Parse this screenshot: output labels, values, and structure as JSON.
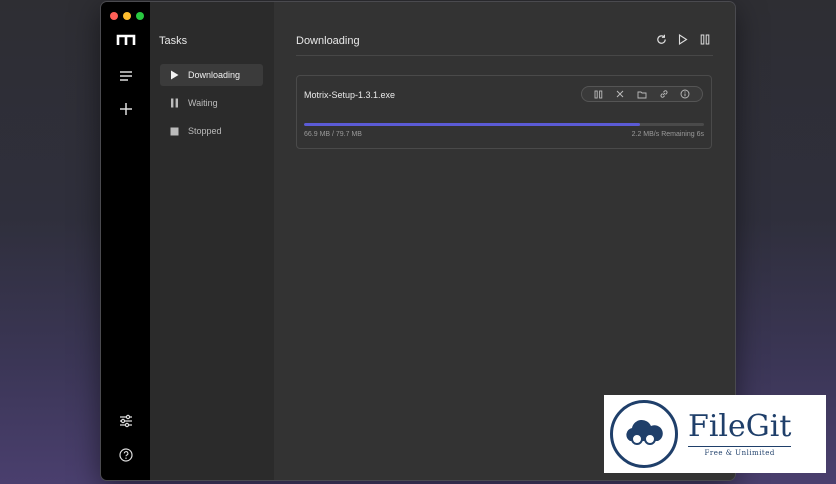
{
  "sidebar": {
    "logo_icon": "motrix-logo-icon",
    "menu_icon": "list-menu-icon",
    "add_icon": "plus-icon",
    "settings_icon": "sliders-icon",
    "help_icon": "help-circle-icon"
  },
  "subnav": {
    "title": "Tasks",
    "items": [
      {
        "label": "Downloading",
        "icon": "play-icon",
        "active": true
      },
      {
        "label": "Waiting",
        "icon": "pause-icon",
        "active": false
      },
      {
        "label": "Stopped",
        "icon": "stop-icon",
        "active": false
      }
    ]
  },
  "main": {
    "title": "Downloading",
    "actions": [
      "refresh-icon",
      "play-icon",
      "pause-icon"
    ]
  },
  "task": {
    "name": "Motrix-Setup-1.3.1.exe",
    "size": "66.9 MB / 79.7 MB",
    "speed": "2.2 MB/s Remaining 6s",
    "progress": 0.84,
    "actions": [
      "pause-icon",
      "close-icon",
      "folder-icon",
      "link-icon",
      "info-icon"
    ]
  },
  "colors": {
    "accent": "#5b5bd6",
    "sidebar_bg": "#000000",
    "window_bg": "#333333"
  },
  "watermark": {
    "name": "FileGit",
    "tagline": "Free & Unlimited"
  }
}
